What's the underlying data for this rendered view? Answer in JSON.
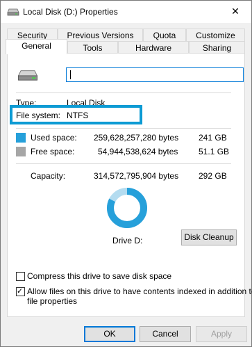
{
  "window": {
    "title": "Local Disk (D:) Properties",
    "close_label": "✕"
  },
  "tabs": [
    {
      "label": "Security"
    },
    {
      "label": "Previous Versions"
    },
    {
      "label": "Quota"
    },
    {
      "label": "Customize"
    },
    {
      "label": "General",
      "active": true
    },
    {
      "label": "Tools"
    },
    {
      "label": "Hardware"
    },
    {
      "label": "Sharing"
    }
  ],
  "general": {
    "name_value": "",
    "type_label": "Type:",
    "type_value": "Local Disk",
    "fs_label": "File system:",
    "fs_value": "NTFS",
    "used_label": "Used space:",
    "used_bytes": "259,628,257,280 bytes",
    "used_gb": "241 GB",
    "free_label": "Free space:",
    "free_bytes": "54,944,538,624 bytes",
    "free_gb": "51.1 GB",
    "capacity_label": "Capacity:",
    "capacity_bytes": "314,572,795,904 bytes",
    "capacity_gb": "292 GB",
    "drive_label": "Drive D:",
    "disk_cleanup": "Disk Cleanup",
    "compress_label": "Compress this drive to save disk space",
    "compress_checked": false,
    "index_label_line1": "Allow files on this drive to have contents indexed in addition to",
    "index_label_line2": "file properties",
    "index_checked": true
  },
  "donut": {
    "used_fraction": 0.8253,
    "used_color": "#26a0da",
    "free_color": "#b4dcf0"
  },
  "colors": {
    "used": "#26a0da",
    "free": "#a6a6a6",
    "highlight": "#0d9bd4"
  },
  "buttons": {
    "ok": "OK",
    "cancel": "Cancel",
    "apply": "Apply"
  }
}
